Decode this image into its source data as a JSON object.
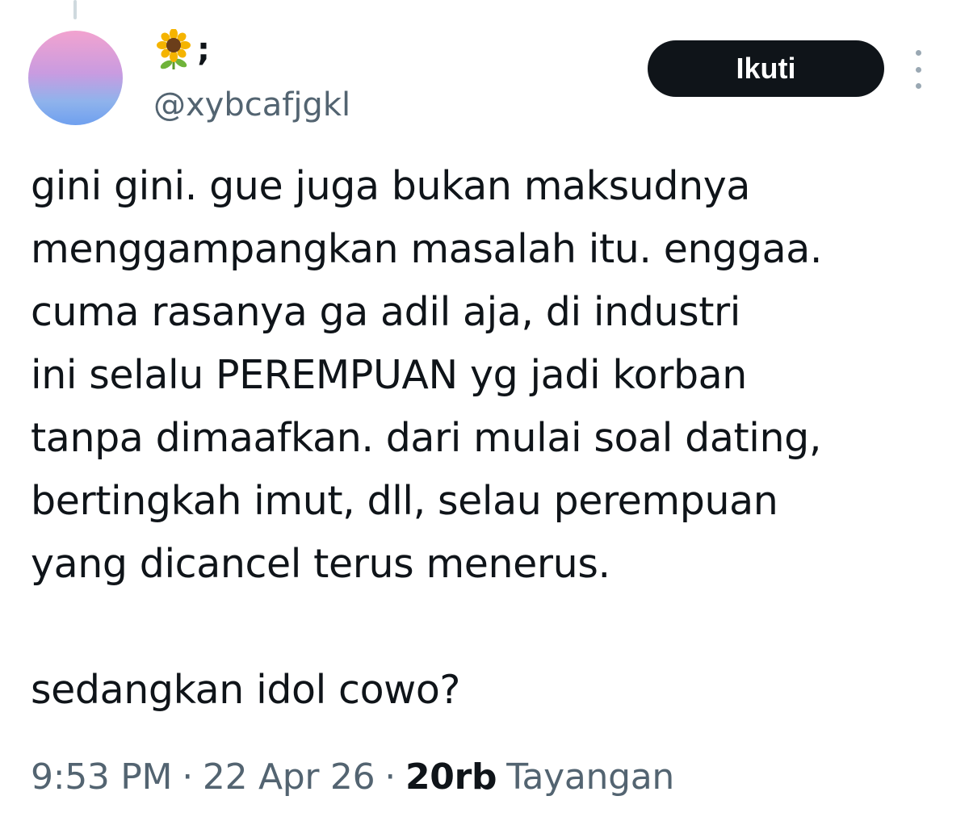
{
  "tweet": {
    "display_name_suffix": ";",
    "display_name_emoji": "sunflower-icon",
    "handle": "@xybcafjgkl",
    "follow_label": "Ikuti",
    "more_icon": "more-vertical-icon",
    "body_lines": [
      "gini gini. gue juga bukan maksudnya",
      "menggampangkan masalah itu. enggaa.",
      "cuma rasanya ga adil aja, di industri",
      "ini selalu PEREMPUAN yg jadi korban",
      "tanpa dimaafkan. dari mulai soal dating,",
      "bertingkah imut, dll, selau perempuan",
      "yang dicancel terus menerus.",
      "",
      "sedangkan idol cowo?"
    ],
    "time": "9:53 PM",
    "date": "22 Apr 26",
    "separator": "·",
    "views_count": "20rb",
    "views_label": "Tayangan"
  },
  "colors": {
    "text_primary": "#0f1419",
    "text_secondary": "#536471",
    "follow_button_bg": "#0f1419",
    "follow_button_text": "#ffffff",
    "thread_line": "#cfd9de"
  }
}
